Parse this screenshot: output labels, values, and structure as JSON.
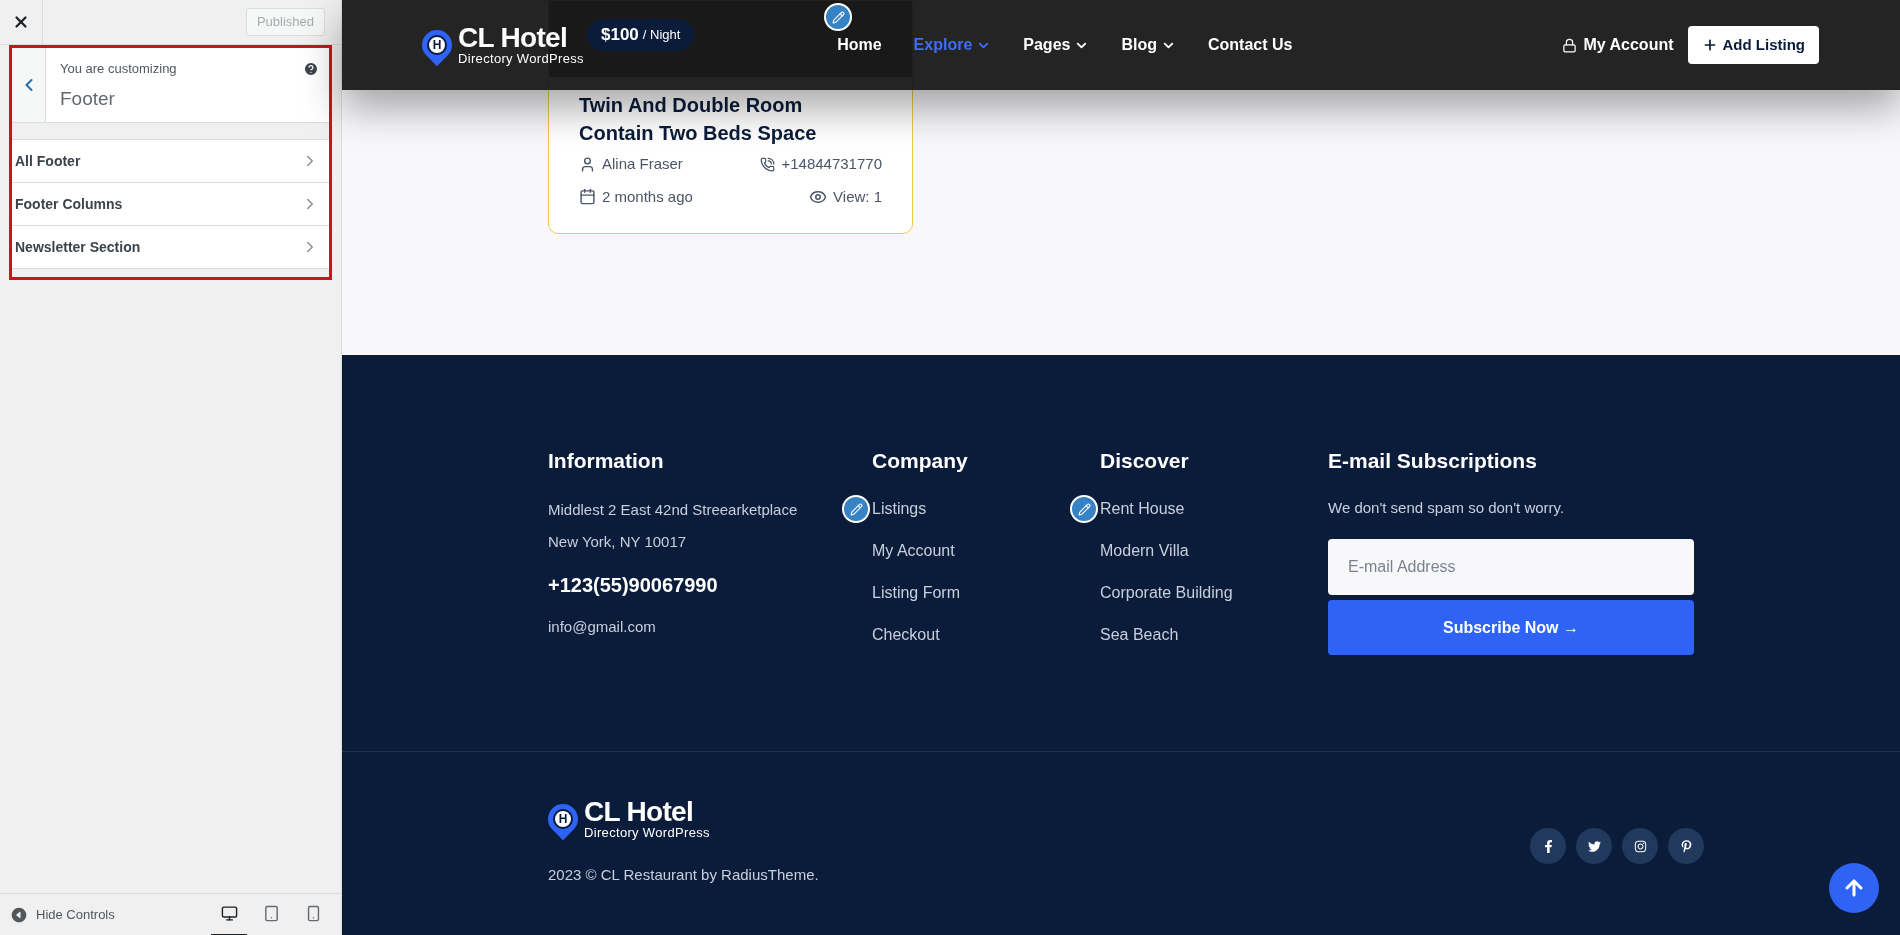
{
  "customizer": {
    "publish_button": {
      "label": "Published",
      "disabled": true
    },
    "header": {
      "subtitle": "You are customizing",
      "title": "Footer"
    },
    "sections": [
      {
        "label": "All Footer"
      },
      {
        "label": "Footer Columns"
      },
      {
        "label": "Newsletter Section"
      }
    ],
    "footer_controls": {
      "hide_label": "Hide Controls",
      "devices": [
        {
          "kind": "desktop",
          "selected": true
        },
        {
          "kind": "tablet",
          "selected": false
        },
        {
          "kind": "mobile",
          "selected": false
        }
      ]
    }
  },
  "preview": {
    "nav": {
      "logo": {
        "mark": "H",
        "name": "CL Hotel",
        "tagline": "Directory WordPress"
      },
      "links": [
        {
          "label": "Home",
          "selected": false,
          "dropdown": false
        },
        {
          "label": "Explore",
          "selected": true,
          "dropdown": true
        },
        {
          "label": "Pages",
          "selected": false,
          "dropdown": true
        },
        {
          "label": "Blog",
          "selected": false,
          "dropdown": true
        },
        {
          "label": "Contact Us",
          "selected": false,
          "dropdown": false
        }
      ],
      "account": "My Account",
      "add_button": "Add Listing"
    },
    "listing": {
      "price": "$100",
      "unit": "/ Night",
      "title": "Twin And Double Room Contain Two Beds Space",
      "author": "Alina Fraser",
      "phone": "+14844731770",
      "date": "2 months ago",
      "views": "View: 1"
    },
    "footer": {
      "information": {
        "heading": "Information",
        "address_lines": [
          "Middlest 2 East 42nd Streearketplace",
          "New York, NY 10017"
        ],
        "phone": "+123(55)90067990",
        "email": "info@gmail.com"
      },
      "company": {
        "heading": "Company",
        "links": [
          "Listings",
          "My Account",
          "Listing Form",
          "Checkout"
        ]
      },
      "discover": {
        "heading": "Discover",
        "links": [
          "Rent House",
          "Modern Villa",
          "Corporate Building",
          "Sea Beach"
        ]
      },
      "subscribe": {
        "heading": "E-mail Subscriptions",
        "text": "We don't send spam so don't worry.",
        "placeholder": "E-mail Address",
        "button": "Subscribe Now →"
      },
      "bottom": {
        "logo": {
          "mark": "H",
          "name": "CL Hotel",
          "tagline": "Directory WordPress"
        },
        "copyright": "2023 © CL Restaurant by RadiusTheme.",
        "socials": [
          {
            "kind": "facebook"
          },
          {
            "kind": "twitter"
          },
          {
            "kind": "instagram"
          },
          {
            "kind": "pinterest"
          }
        ]
      }
    }
  }
}
